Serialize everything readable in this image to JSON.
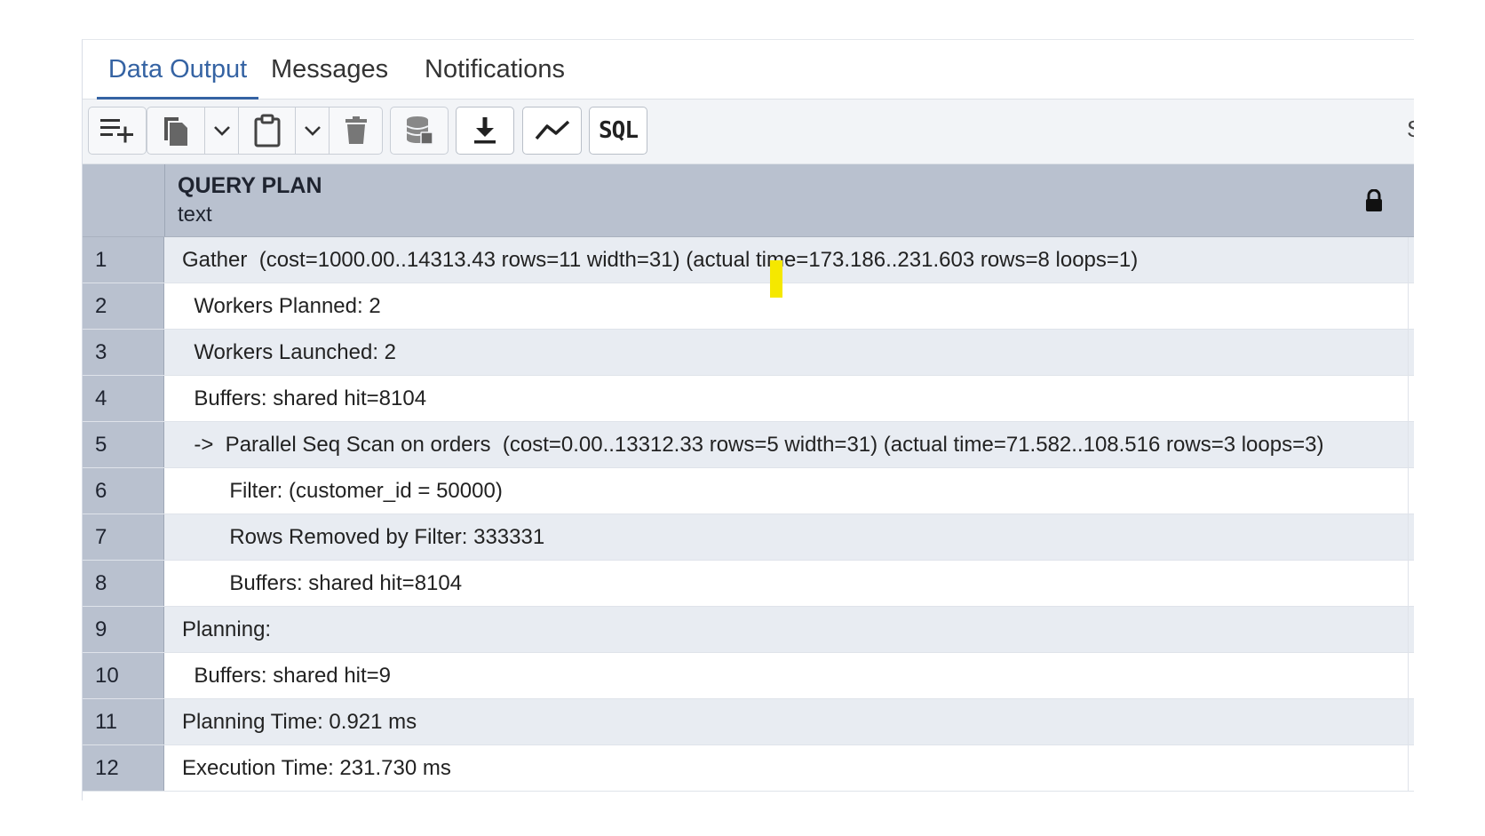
{
  "tabs": [
    {
      "label": "Data Output",
      "active": true
    },
    {
      "label": "Messages",
      "active": false
    },
    {
      "label": "Notifications",
      "active": false
    }
  ],
  "toolbar": {
    "icons": [
      "add-row-icon",
      "copy-icon",
      "chevron-down-icon",
      "paste-icon",
      "chevron-down-icon",
      "delete-icon",
      "save-data-icon",
      "download-icon",
      "graph-icon",
      "sql-icon"
    ],
    "sql_label": "SQL",
    "edge_glyph": "S"
  },
  "grid": {
    "column": {
      "name": "QUERY PLAN",
      "type": "text"
    },
    "rows": [
      {
        "num": "1",
        "text": "Gather  (cost=1000.00..14313.43 rows=11 width=31) (actual time=173.186..231.603 rows=8 loops=1)"
      },
      {
        "num": "2",
        "text": "  Workers Planned: 2"
      },
      {
        "num": "3",
        "text": "  Workers Launched: 2"
      },
      {
        "num": "4",
        "text": "  Buffers: shared hit=8104"
      },
      {
        "num": "5",
        "text": "  ->  Parallel Seq Scan on orders  (cost=0.00..13312.33 rows=5 width=31) (actual time=71.582..108.516 rows=3 loops=3)"
      },
      {
        "num": "6",
        "text": "        Filter: (customer_id = 50000)"
      },
      {
        "num": "7",
        "text": "        Rows Removed by Filter: 333331"
      },
      {
        "num": "8",
        "text": "        Buffers: shared hit=8104"
      },
      {
        "num": "9",
        "text": "Planning:"
      },
      {
        "num": "10",
        "text": "  Buffers: shared hit=9"
      },
      {
        "num": "11",
        "text": "Planning Time: 0.921 ms"
      },
      {
        "num": "12",
        "text": "Execution Time: 231.730 ms"
      }
    ]
  },
  "colors": {
    "accent": "#3563a3",
    "header_bg": "#b9c1cf",
    "row_alt_bg": "#e8ecf2",
    "highlight": "#f5e800"
  }
}
